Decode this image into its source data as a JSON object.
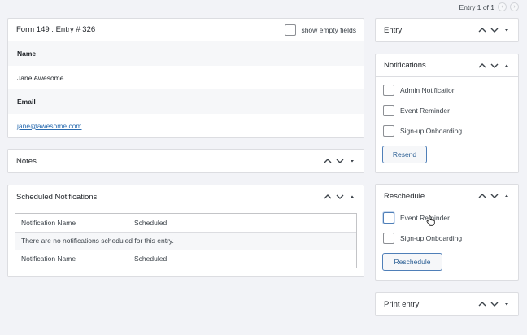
{
  "pager": {
    "label": "Entry 1 of 1",
    "prev": "‹",
    "next": "›"
  },
  "entry_panel": {
    "title": "Form 149 : Entry # 326",
    "show_empty_label": "show empty fields",
    "fields": [
      {
        "label": "Name",
        "value": "Jane Awesome"
      },
      {
        "label": "Email",
        "value": "jane@awesome.com"
      }
    ]
  },
  "notes_panel": {
    "title": "Notes"
  },
  "scheduled_panel": {
    "title": "Scheduled Notifications",
    "columns": [
      "Notification Name",
      "Scheduled"
    ],
    "empty_message": "There are no notifications scheduled for this entry."
  },
  "sidebar": {
    "entry": {
      "title": "Entry"
    },
    "notifications": {
      "title": "Notifications",
      "items": [
        "Admin Notification",
        "Event Reminder",
        "Sign-up Onboarding"
      ],
      "button": "Resend"
    },
    "reschedule": {
      "title": "Reschedule",
      "items": [
        "Event Reminder",
        "Sign-up Onboarding"
      ],
      "button": "Reschedule"
    },
    "print": {
      "title": "Print entry"
    }
  },
  "icons": {
    "up": "chevron-up-icon",
    "down": "chevron-down-icon",
    "toggle": "triangle-toggle-icon",
    "cursor": "hand-pointer-icon"
  },
  "colors": {
    "background": "#f2f3f7",
    "link": "#2b6cb0",
    "button_border": "#4f7fb8"
  }
}
